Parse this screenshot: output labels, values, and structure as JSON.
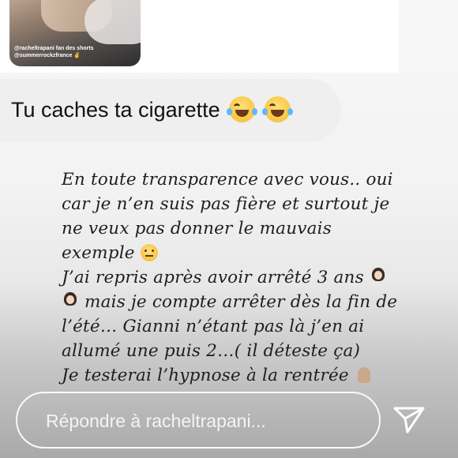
{
  "story": {
    "thumbnail_caption": [
      "@racheltrapani fan des shorts",
      "@summerrockzfrance ✌"
    ],
    "reply_message": "Tu caches ta cigarette",
    "reply_emojis": [
      "face-with-tears-of-joy-emoji",
      "face-with-tears-of-joy-emoji"
    ]
  },
  "message": {
    "lines": [
      "En toute transparence avec vous.. oui",
      "car je n’en suis pas fière et surtout je",
      "ne veux pas donner le mauvais",
      "exemple",
      "J’ai repris après avoir arrêté 3 ans",
      "mais je compte arrêter dès la fin de",
      "l’été… Gianni n’étant pas là j’en ai",
      "allumé une puis 2…( il déteste ça)",
      "Je testerai l’hypnose à la rentrée"
    ]
  },
  "composer": {
    "placeholder": "Répondre à racheltrapani..."
  },
  "colors": {
    "bubble": "#efefef",
    "text": "#1e1e1e",
    "composer_border": "#ffffff"
  }
}
